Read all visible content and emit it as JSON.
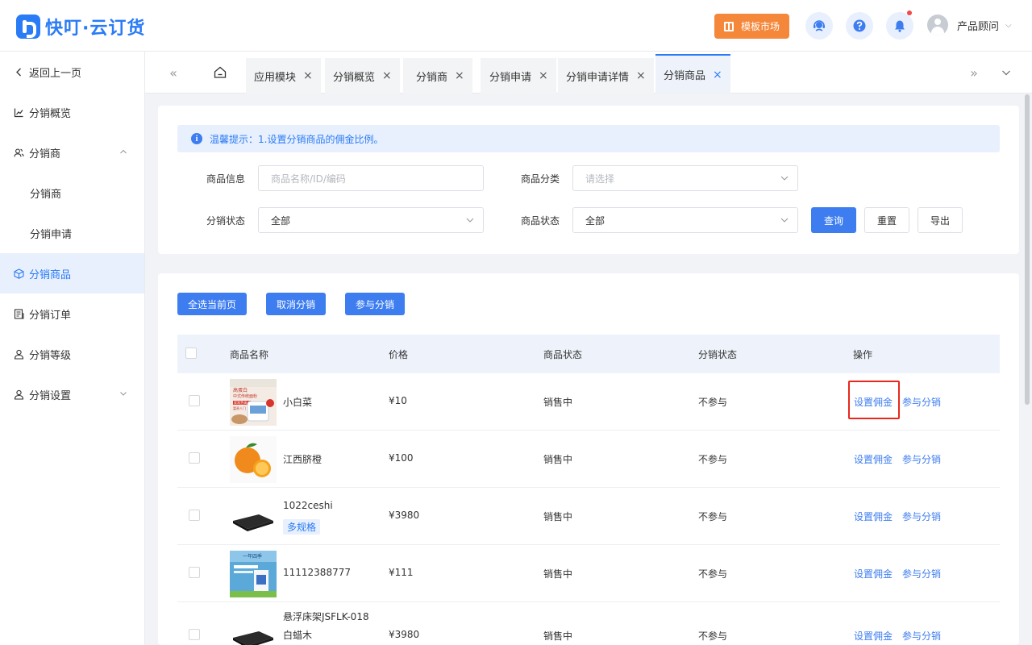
{
  "header": {
    "brand": "快叮·云订货",
    "market_label": "模板市场",
    "user_name": "产品顾问",
    "user_caret": "⌵"
  },
  "sidebar": {
    "items": [
      {
        "label": "返回上一页"
      },
      {
        "label": "分销概览"
      },
      {
        "label": "分销商"
      },
      {
        "label": "分销商"
      },
      {
        "label": "分销申请"
      },
      {
        "label": "分销商品"
      },
      {
        "label": "分销订单"
      },
      {
        "label": "分销等级"
      },
      {
        "label": "分销设置"
      }
    ]
  },
  "tabs": [
    {
      "label": "应用模块"
    },
    {
      "label": "分销概览"
    },
    {
      "label": "分销商"
    },
    {
      "label": "分销申请"
    },
    {
      "label": "分销申请详情"
    },
    {
      "label": "分销商品"
    }
  ],
  "tab_close": "×",
  "tab_prev": "«",
  "tab_next": "»",
  "tip": {
    "icon": "i",
    "text": "温馨提示：1.设置分销商品的佣金比例。"
  },
  "filters": {
    "product_info_label": "商品信息",
    "product_info_placeholder": "商品名称/ID/编码",
    "category_label": "商品分类",
    "category_value": "请选择",
    "dist_status_label": "分销状态",
    "dist_status_value": "全部",
    "product_status_label": "商品状态",
    "product_status_value": "全部",
    "query_btn": "查询",
    "reset_btn": "重置",
    "export_btn": "导出"
  },
  "bulk_actions": {
    "select_page": "全选当前页",
    "cancel_dist": "取消分销",
    "join_dist": "参与分销"
  },
  "table": {
    "headers": [
      "商品名称",
      "价格",
      "商品状态",
      "分销状态",
      "操作"
    ],
    "rows": [
      {
        "name": "小白菜",
        "name2": "",
        "tag": "",
        "price": "¥10",
        "status": "销售中",
        "dist": "不参与",
        "op1": "设置佣金",
        "op2": "参与分销"
      },
      {
        "name": "江西脐橙",
        "name2": "",
        "tag": "",
        "price": "¥100",
        "status": "销售中",
        "dist": "不参与",
        "op1": "设置佣金",
        "op2": "参与分销"
      },
      {
        "name": "1022ceshi",
        "name2": "",
        "tag": "多规格",
        "price": "¥3980",
        "status": "销售中",
        "dist": "不参与",
        "op1": "设置佣金",
        "op2": "参与分销"
      },
      {
        "name": "11112388777",
        "name2": "",
        "tag": "",
        "price": "¥111",
        "status": "销售中",
        "dist": "不参与",
        "op1": "设置佣金",
        "op2": "参与分销"
      },
      {
        "name": "悬浮床架JSFLK-018",
        "name2": "白蜡木",
        "tag": "",
        "price": "¥3980",
        "status": "销售中",
        "dist": "不参与",
        "op1": "设置佣金",
        "op2": "参与分销"
      }
    ]
  },
  "thumb_text": {
    "r0_line1": "高蛋白",
    "r0_line2": "中式传统面粉",
    "r0_line3": "家常烹调",
    "r0_line4": "富贵人门",
    "r3_line1": "一年四季"
  },
  "colors": {
    "accent": "#2a7bf6",
    "market": "#f5873a",
    "highlight": "#e8281c"
  }
}
